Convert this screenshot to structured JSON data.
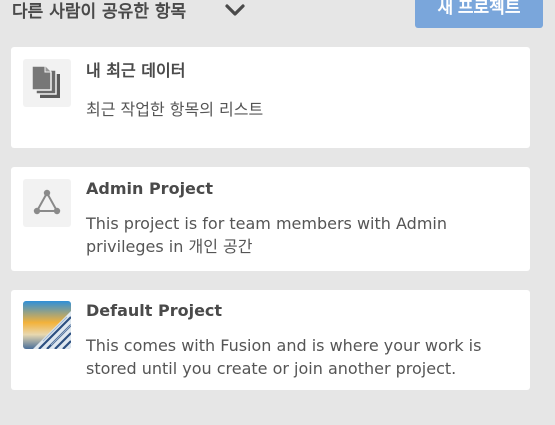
{
  "header": {
    "dropdown_label": "다른 사람이 공유한 항목",
    "new_project_label": "새 프로젝트"
  },
  "cards": [
    {
      "title": "내 최근 데이터",
      "description": "최근 작업한 항목의 리스트",
      "icon": "documents-icon"
    },
    {
      "title": "Admin Project",
      "description": "This project is for team members with Admin privileges in 개인 공간",
      "icon": "project-network-icon"
    },
    {
      "title": "Default Project",
      "description": "This comes with Fusion and is where your work is stored until you create or join another project.",
      "icon": "project-thumbnail-image"
    }
  ],
  "colors": {
    "background": "#e6e6e6",
    "card": "#ffffff",
    "accent_button": "#7aa6db",
    "text_dark": "#4a4a4a"
  }
}
